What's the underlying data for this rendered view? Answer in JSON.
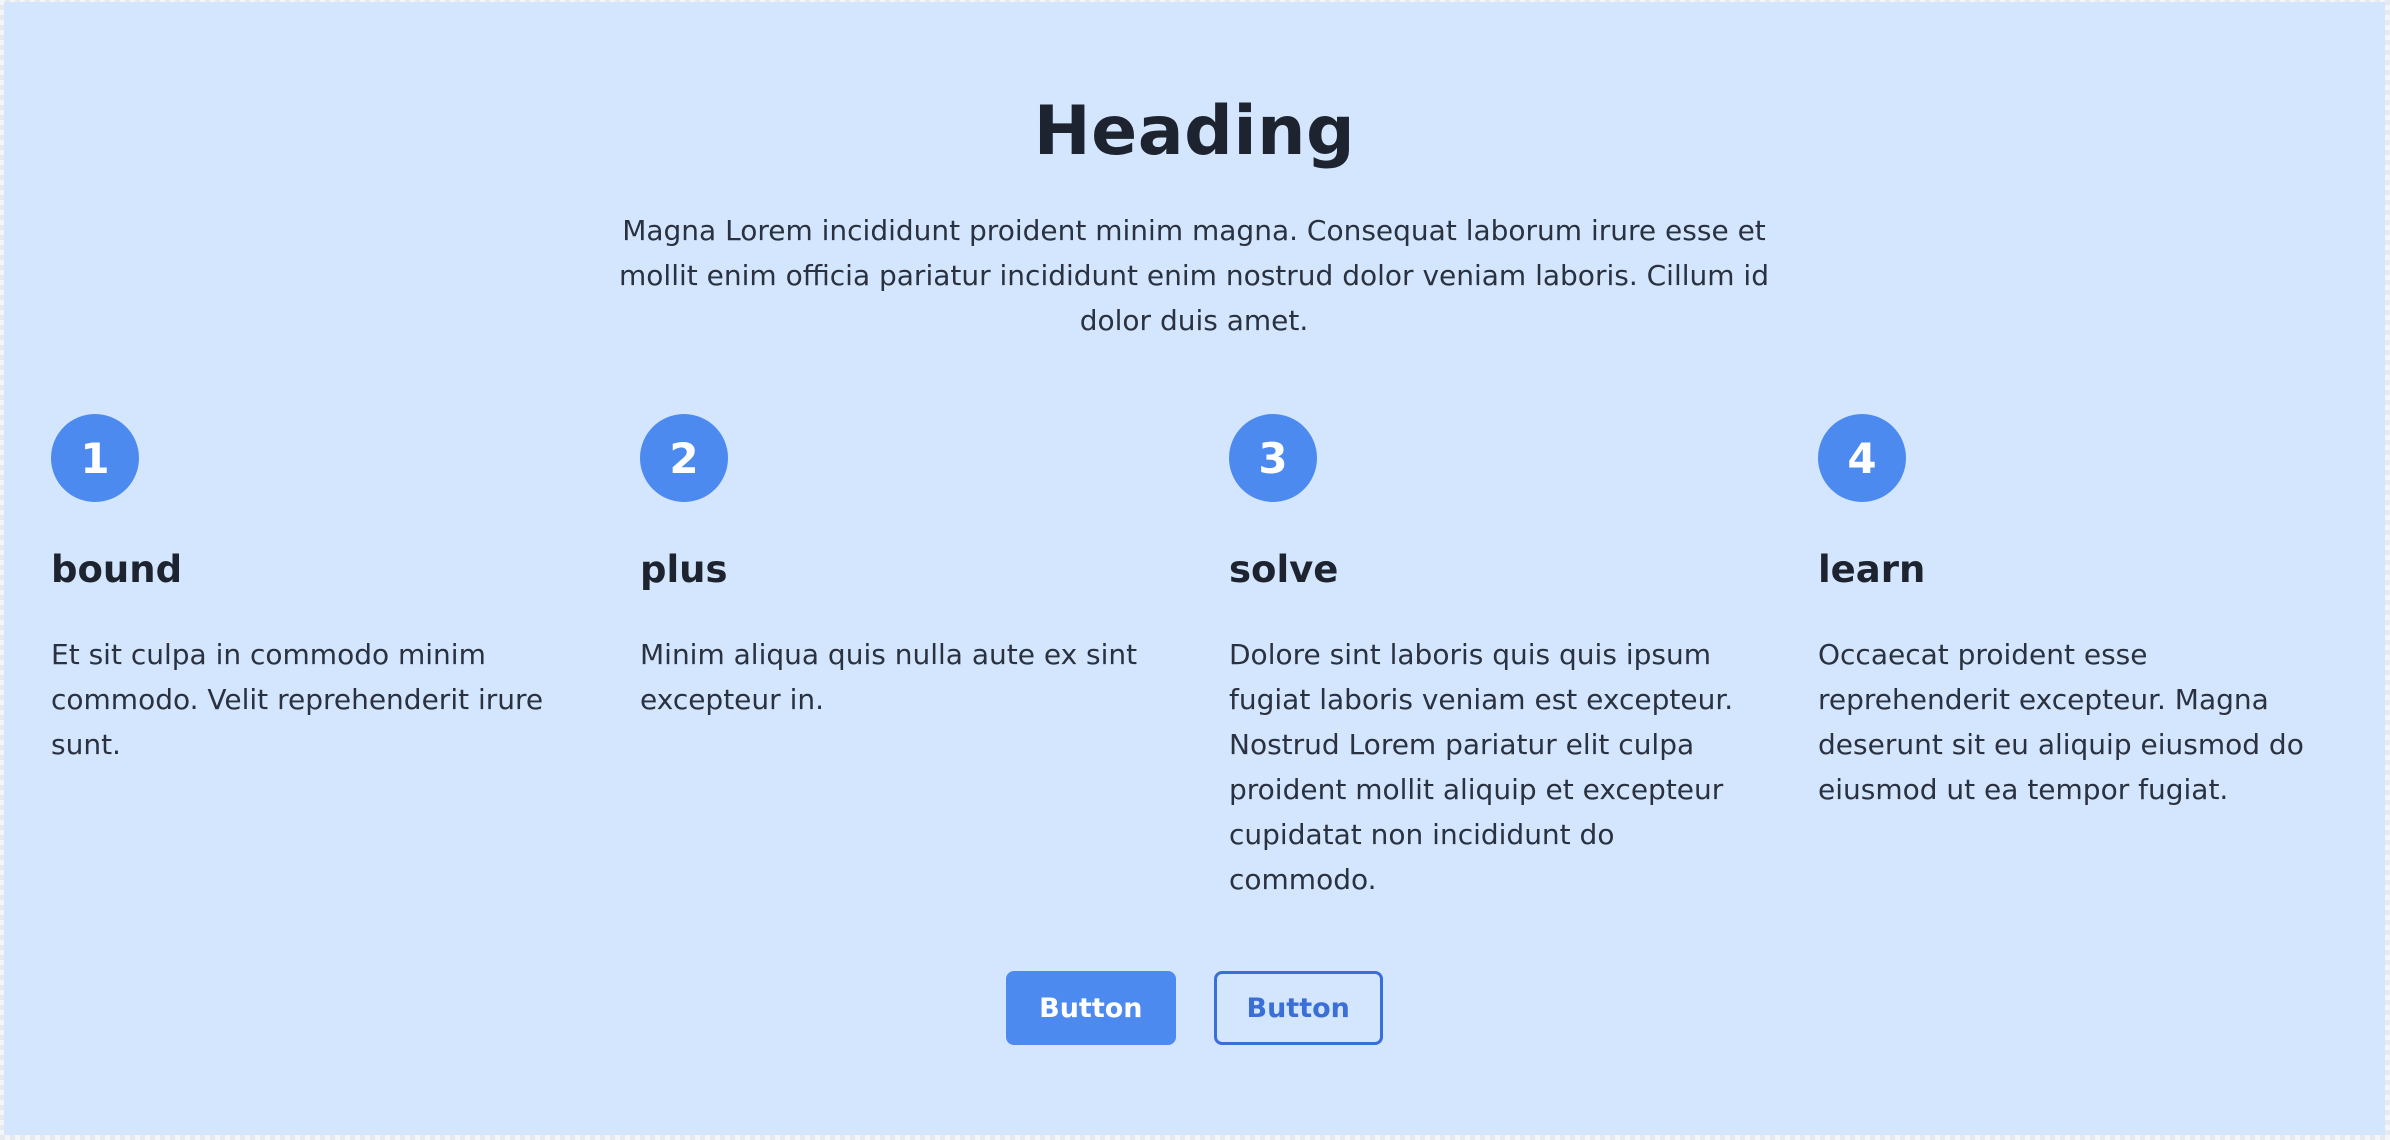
{
  "section": {
    "heading": "Heading",
    "intro": "Magna Lorem incididunt proident minim magna. Consequat laborum irure esse et mollit enim officia pariatur incididunt enim nostrud dolor veniam laboris. Cillum id dolor duis amet."
  },
  "features": [
    {
      "number": "1",
      "title": "bound",
      "text": "Et sit culpa in commodo minim commodo. Velit reprehenderit irure sunt."
    },
    {
      "number": "2",
      "title": "plus",
      "text": "Minim aliqua quis nulla aute ex sint excepteur in."
    },
    {
      "number": "3",
      "title": "solve",
      "text": "Dolore sint laboris quis quis ipsum fugiat laboris veniam est excepteur. Nostrud Lorem pariatur elit culpa proident mollit aliquip et excepteur cupidatat non incididunt do commodo."
    },
    {
      "number": "4",
      "title": "learn",
      "text": "Occaecat proident esse reprehenderit excepteur. Magna deserunt sit eu aliquip eiusmod do eiusmod ut ea tempor fugiat."
    }
  ],
  "actions": {
    "primary_label": "Button",
    "secondary_label": "Button"
  },
  "colors": {
    "background": "#d4e6fd",
    "accent": "#4d8af0",
    "outline_accent": "#3a6fd8",
    "text": "#1d2430"
  }
}
